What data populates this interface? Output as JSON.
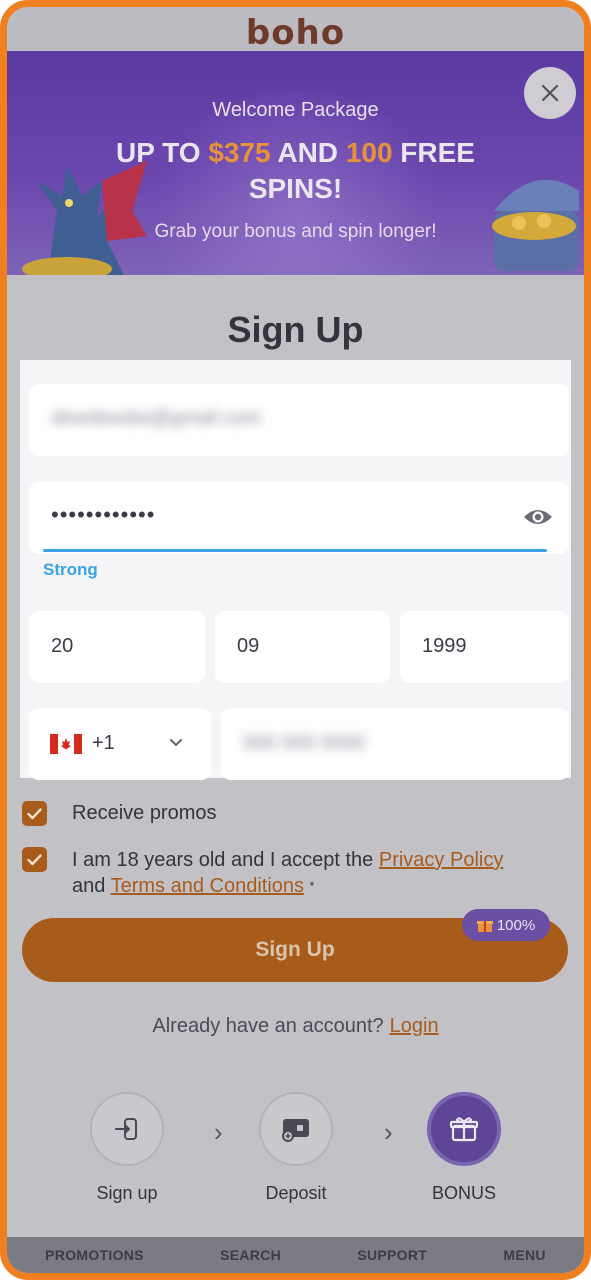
{
  "app": {
    "logo": "boho"
  },
  "banner": {
    "subtitle": "Welcome Package",
    "title_parts": [
      "UP TO ",
      "$375",
      " AND ",
      "100",
      " FREE SPINS!"
    ],
    "description": "Grab your bonus and spin longer!",
    "close_icon": "close-icon"
  },
  "form": {
    "title": "Sign Up",
    "email_value": "dewdewdw@gmail.com",
    "password_value": "••••••••••••",
    "password_strength": "Strong",
    "dob_day": "20",
    "dob_month": "09",
    "dob_year": "1999",
    "phone_country_code": "+1",
    "phone_country": "Canada",
    "phone_value": "000 000 0000",
    "receive_promos_label": "Receive promos",
    "receive_promos_checked": true,
    "terms_text_1": "I am 18 years old and I accept the ",
    "privacy_policy_link": "Privacy Policy",
    "terms_text_2": "and ",
    "terms_link": "Terms and Conditions",
    "terms_required_mark": "*",
    "terms_checked": true,
    "submit_label": "Sign Up",
    "progress_badge": "100%",
    "login_prompt": "Already have an account?",
    "login_link": "Login"
  },
  "steps": [
    {
      "label": "Sign up",
      "icon": "sign-in-icon"
    },
    {
      "label": "Deposit",
      "icon": "wallet-icon"
    },
    {
      "label": "BONUS",
      "icon": "gift-icon"
    }
  ],
  "bottom_nav": [
    "PROMOTIONS",
    "SEARCH",
    "SUPPORT",
    "MENU"
  ],
  "colors": {
    "accent_orange": "#f07f1f",
    "primary_purple": "#5e4595",
    "strength_blue": "#3aa3e6"
  }
}
